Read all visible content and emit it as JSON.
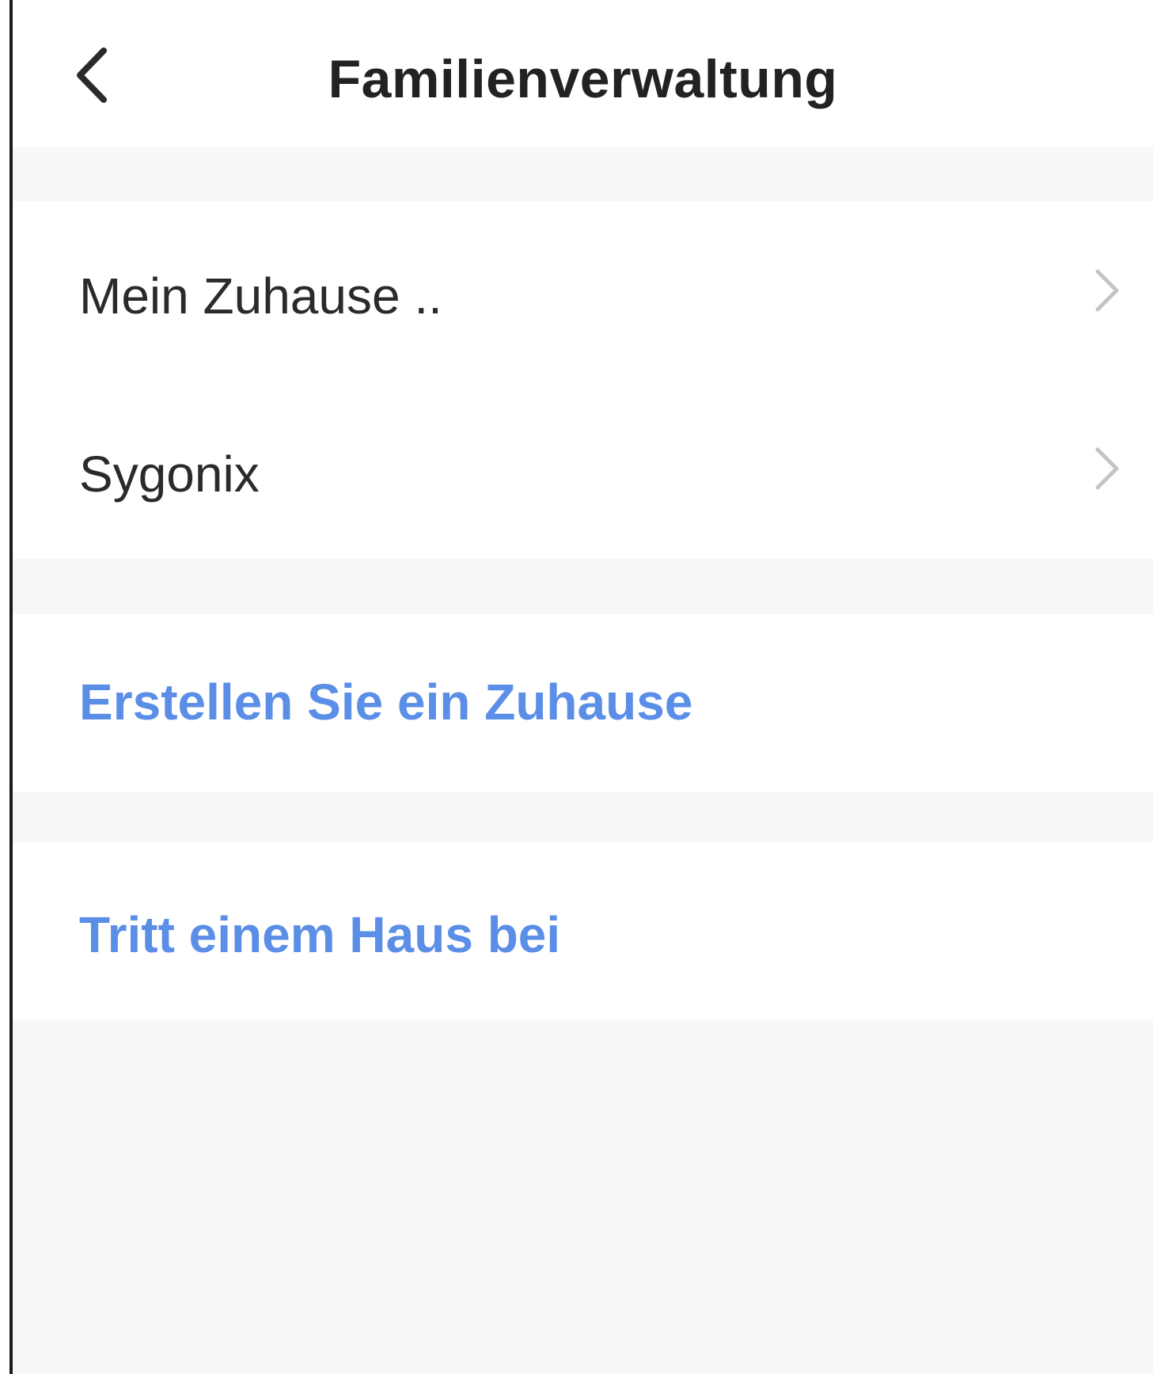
{
  "header": {
    "title": "Familienverwaltung",
    "back_icon": "chevron-left-icon"
  },
  "homes": [
    {
      "label": "Mein Zuhause ..",
      "icon": "chevron-right-icon"
    },
    {
      "label": "Sygonix",
      "icon": "chevron-right-icon"
    }
  ],
  "actions": {
    "create_home": "Erstellen Sie ein Zuhause",
    "join_home": "Tritt einem Haus bei"
  },
  "colors": {
    "accent": "#5b8ee6",
    "background": "#f7f7f7",
    "surface": "#ffffff",
    "text_primary": "#2a2a2a",
    "chevron": "#c4c4c4"
  }
}
